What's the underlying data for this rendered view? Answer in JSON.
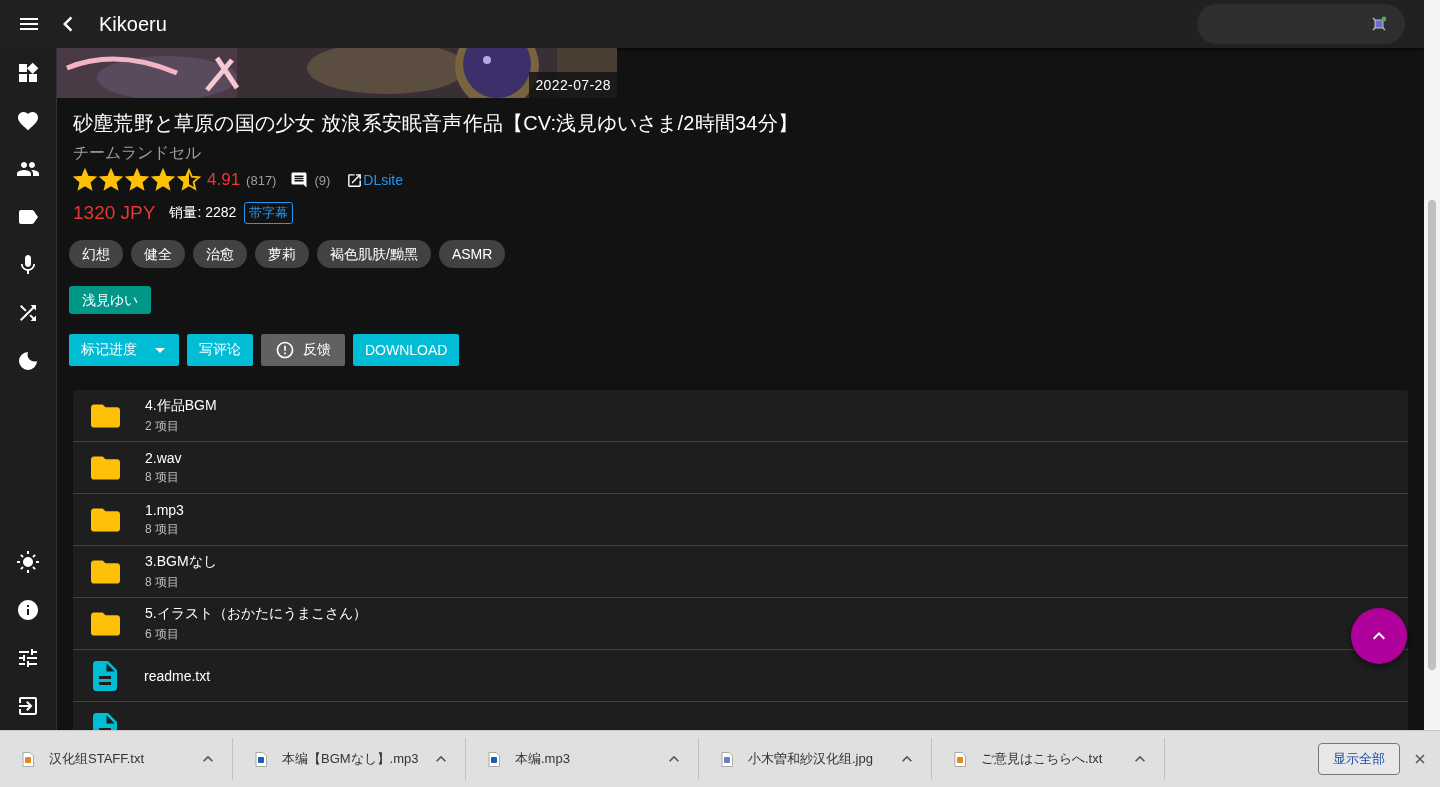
{
  "app_bar": {
    "title": "Kikoeru"
  },
  "work": {
    "release_date": "2022-07-28",
    "title": "砂塵荒野と草原の国の少女 放浪系安眠音声作品【CV:浅見ゆいさま/2時間34分】",
    "circle": "チームランドセル",
    "stars": 4.5,
    "rating": "4.91",
    "rating_count": "(817)",
    "review_count": "(9)",
    "link": "DLsite",
    "price": "1320 JPY",
    "sales": "销量: 2282",
    "subtitle_badge": "带字幕",
    "tags": [
      "幻想",
      "健全",
      "治愈",
      "萝莉",
      "褐色肌肤/黝黑",
      "ASMR"
    ],
    "voice_actors": [
      "浅見ゆい"
    ],
    "actions": [
      {
        "kind": "menu",
        "label": "标记进度"
      },
      {
        "kind": "plain",
        "label": "写评论"
      },
      {
        "kind": "report",
        "label": "反馈"
      },
      {
        "kind": "plain",
        "label": "DOWNLOAD"
      }
    ]
  },
  "files": [
    {
      "kind": "folder",
      "name": "4.作品BGM",
      "count": "2 项目"
    },
    {
      "kind": "folder",
      "name": "2.wav",
      "count": "8 项目"
    },
    {
      "kind": "folder",
      "name": "1.mp3",
      "count": "8 项目"
    },
    {
      "kind": "folder",
      "name": "3.BGMなし",
      "count": "8 项目"
    },
    {
      "kind": "folder",
      "name": "5.イラスト（おかたにうまこさん）",
      "count": "6 项目"
    },
    {
      "kind": "file",
      "name": "readme.txt"
    },
    {
      "kind": "file"
    }
  ],
  "downloads": {
    "items": [
      {
        "name": "汉化组STAFF.txt",
        "color": "#e08a1e"
      },
      {
        "name": "本编【BGMなし】.mp3",
        "color": "#1a5fb4"
      },
      {
        "name": "本编.mp3",
        "color": "#1a5fb4"
      },
      {
        "name": "小木曽和紗汉化组.jpg",
        "color": "#6a7fc0"
      },
      {
        "name": "ご意見はこちらへ.txt",
        "color": "#e08a1e"
      }
    ],
    "show_all": "显示全部"
  }
}
